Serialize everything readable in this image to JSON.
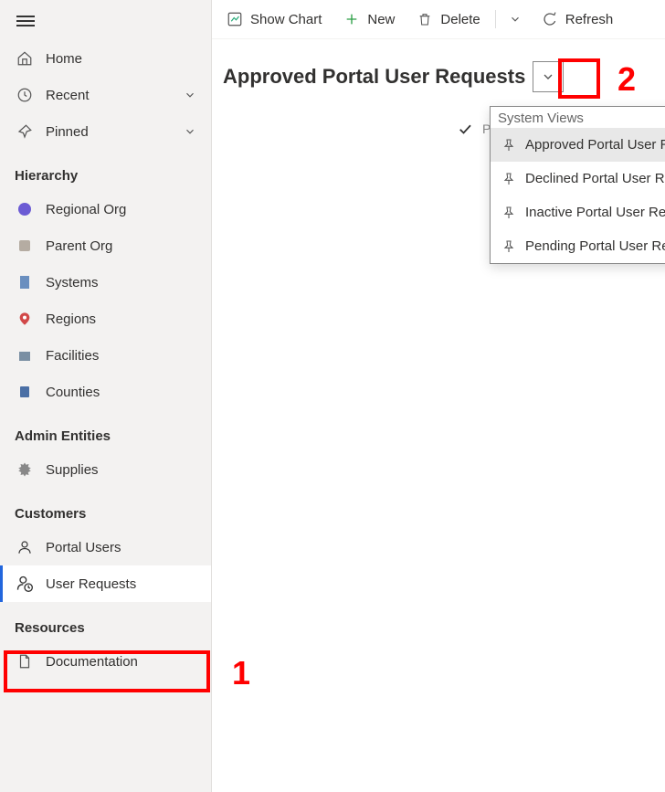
{
  "sidebar": {
    "home": "Home",
    "recent": "Recent",
    "pinned": "Pinned",
    "group_hierarchy": "Hierarchy",
    "hierarchy": {
      "regional_org": "Regional Org",
      "parent_org": "Parent Org",
      "systems": "Systems",
      "regions": "Regions",
      "facilities": "Facilities",
      "counties": "Counties"
    },
    "group_admin": "Admin Entities",
    "admin": {
      "supplies": "Supplies"
    },
    "group_customers": "Customers",
    "customers": {
      "portal_users": "Portal Users",
      "user_requests": "User Requests"
    },
    "group_resources": "Resources",
    "resources": {
      "documentation": "Documentation"
    }
  },
  "commandbar": {
    "show_chart": "Show Chart",
    "new": "New",
    "delete": "Delete",
    "refresh": "Refresh"
  },
  "page_title": "Approved Portal User Requests",
  "dropdown": {
    "header": "System Views",
    "items": [
      "Approved Portal User Requests",
      "Declined Portal User Requests",
      "Inactive Portal User Requests",
      "Pending Portal User Requests"
    ]
  },
  "obscured_text": "P",
  "annotations": {
    "one": "1",
    "two": "2"
  }
}
